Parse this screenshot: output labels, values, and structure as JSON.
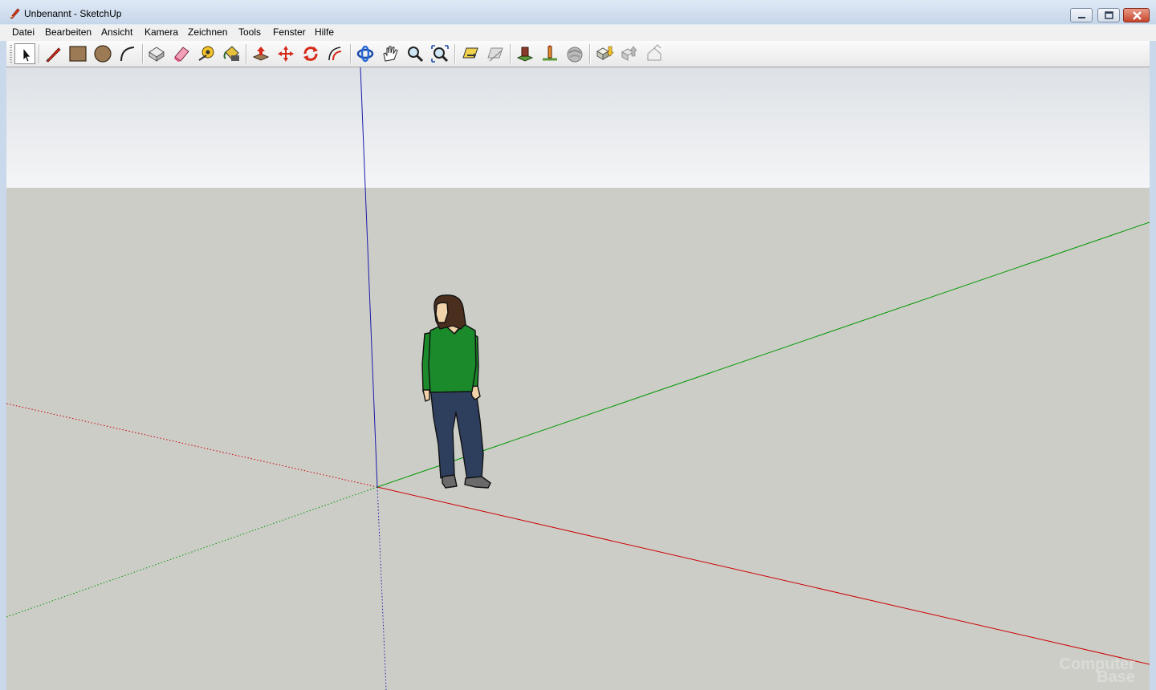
{
  "window": {
    "title": "Unbenannt - SketchUp",
    "controls": {
      "minimize_icon": "minimize-icon",
      "maximize_icon": "restore-icon",
      "close_icon": "close-icon"
    }
  },
  "menu": {
    "items": [
      {
        "id": "datei",
        "label": "Datei"
      },
      {
        "id": "bearbeiten",
        "label": "Bearbeiten"
      },
      {
        "id": "ansicht",
        "label": "Ansicht"
      },
      {
        "id": "kamera",
        "label": "Kamera"
      },
      {
        "id": "zeichnen",
        "label": "Zeichnen"
      },
      {
        "id": "tools",
        "label": "Tools"
      },
      {
        "id": "fenster",
        "label": "Fenster"
      },
      {
        "id": "hilfe",
        "label": "Hilfe"
      }
    ]
  },
  "toolbar": {
    "tools": [
      {
        "icon": "select-icon",
        "active": true
      },
      {
        "icon": "pencil-line-icon"
      },
      {
        "icon": "rectangle-icon"
      },
      {
        "icon": "circle-icon"
      },
      {
        "icon": "arc-icon"
      },
      {
        "icon": "make-component-icon"
      },
      {
        "icon": "eraser-icon"
      },
      {
        "icon": "tape-measure-icon"
      },
      {
        "icon": "paint-bucket-icon"
      },
      {
        "icon": "push-pull-icon"
      },
      {
        "icon": "move-icon"
      },
      {
        "icon": "rotate-icon"
      },
      {
        "icon": "offset-icon"
      },
      {
        "icon": "orbit-icon"
      },
      {
        "icon": "pan-icon"
      },
      {
        "icon": "zoom-icon"
      },
      {
        "icon": "zoom-extents-icon"
      },
      {
        "icon": "previous-view-icon"
      },
      {
        "icon": "next-view-icon"
      },
      {
        "icon": "add-location-icon"
      },
      {
        "icon": "toggle-terrain-icon"
      },
      {
        "icon": "google-earth-icon"
      },
      {
        "icon": "get-models-icon"
      },
      {
        "icon": "share-model-icon"
      },
      {
        "icon": "share-component-icon"
      }
    ]
  },
  "viewport": {
    "colors": {
      "sky_top": "#dde1e6",
      "sky_bottom": "#f4f5f6",
      "ground": "#cdcdc8",
      "axis_red": "#cc0000",
      "axis_green": "#009900",
      "axis_blue": "#1a1aaa",
      "shirt": "#1a8a2a",
      "jeans": "#2e3f5e",
      "hair": "#4a2e1e",
      "skin": "#f2d2a8"
    },
    "scale_figure": "person-figure",
    "watermark": {
      "line1": "Computer",
      "line2": "Base"
    }
  }
}
